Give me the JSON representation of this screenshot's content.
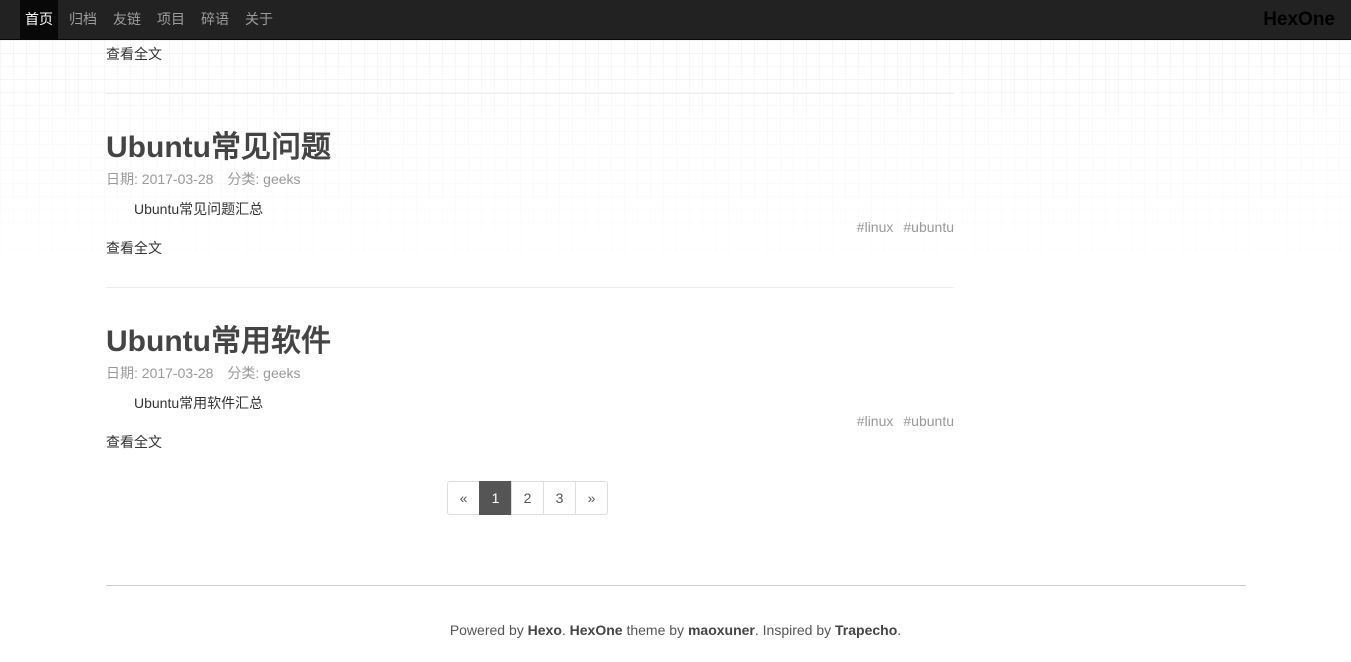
{
  "nav": {
    "items": [
      "首页",
      "归档",
      "友链",
      "项目",
      "碎语",
      "关于"
    ],
    "brand": "HexOne"
  },
  "top_read_more": "查看全文",
  "posts": [
    {
      "title": "Ubuntu常见问题",
      "date_label": "日期: 2017-03-28",
      "category_label": "分类: geeks",
      "excerpt": "Ubuntu常见问题汇总",
      "tags": [
        "#linux",
        "#ubuntu"
      ],
      "read_more": "查看全文"
    },
    {
      "title": "Ubuntu常用软件",
      "date_label": "日期: 2017-03-28",
      "category_label": "分类: geeks",
      "excerpt": "Ubuntu常用软件汇总",
      "tags": [
        "#linux",
        "#ubuntu"
      ],
      "read_more": "查看全文"
    }
  ],
  "pagination": {
    "prev": "«",
    "pages": [
      "1",
      "2",
      "3"
    ],
    "active": "1",
    "next": "»"
  },
  "footer": {
    "powered_by": "Powered by ",
    "hexo": "Hexo",
    "dot1": ". ",
    "theme_name": "HexOne",
    "theme_by": " theme by ",
    "author": "maoxuner",
    "inspired": ". Inspired by ",
    "trapecho": "Trapecho",
    "dot2": "."
  }
}
